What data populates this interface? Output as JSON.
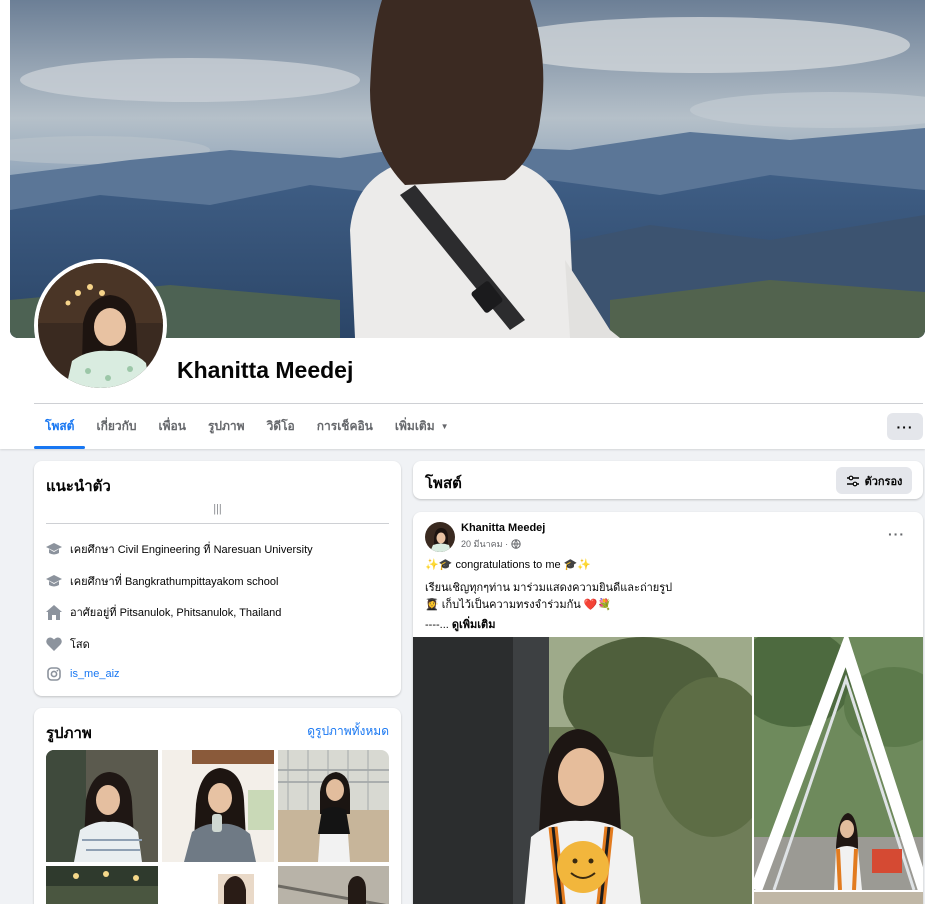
{
  "profile": {
    "name": "Khanitta Meedej"
  },
  "tabs": [
    {
      "label": "โพสต์",
      "active": true
    },
    {
      "label": "เกี่ยวกับ",
      "active": false
    },
    {
      "label": "เพื่อน",
      "active": false
    },
    {
      "label": "รูปภาพ",
      "active": false
    },
    {
      "label": "วิดีโอ",
      "active": false
    },
    {
      "label": "การเช็คอิน",
      "active": false
    },
    {
      "label": "เพิ่มเติม",
      "active": false
    }
  ],
  "more_label": "···",
  "intro": {
    "title": "แนะนำตัว",
    "bars": "|||",
    "items": [
      {
        "icon": "graduation-cap-icon",
        "text": "เคยศึกษา Civil Engineering ที่ Naresuan University"
      },
      {
        "icon": "graduation-cap-icon",
        "text": "เคยศึกษาที่ Bangkrathumpittayakom school"
      },
      {
        "icon": "home-icon",
        "text": "อาศัยอยู่ที่ Pitsanulok, Phitsanulok, Thailand"
      },
      {
        "icon": "heart-icon",
        "text": "โสด"
      },
      {
        "icon": "instagram-icon",
        "text": "is_me_aiz"
      }
    ]
  },
  "photos": {
    "title": "รูปภาพ",
    "see_all": "ดูรูปภาพทั้งหมด"
  },
  "posts_header": {
    "title": "โพสต์",
    "filter_label": "ตัวกรอง"
  },
  "post": {
    "author": "Khanitta Meedej",
    "date": "20 มีนาคม ·",
    "more_label": "···",
    "line1_pre": "✨🎓",
    "line1_text": "congratulations to me",
    "line1_post": "🎓✨",
    "line2": "เรียนเชิญทุกๆท่าน มาร่วมแสดงความยินดีและถ่ายรูป",
    "line3_pre": "👩‍🎓",
    "line3_text": "เก็บไว้เป็นความทรงจำร่วมกัน",
    "line3_post": "❤️💐",
    "line4_prefix": "----...",
    "see_more": "ดูเพิ่มเติม"
  },
  "colors": {
    "accent": "#1877f2",
    "background": "#f0f2f5",
    "card": "#ffffff",
    "secondary_text": "#65676b",
    "button_gray": "#e4e6eb"
  }
}
